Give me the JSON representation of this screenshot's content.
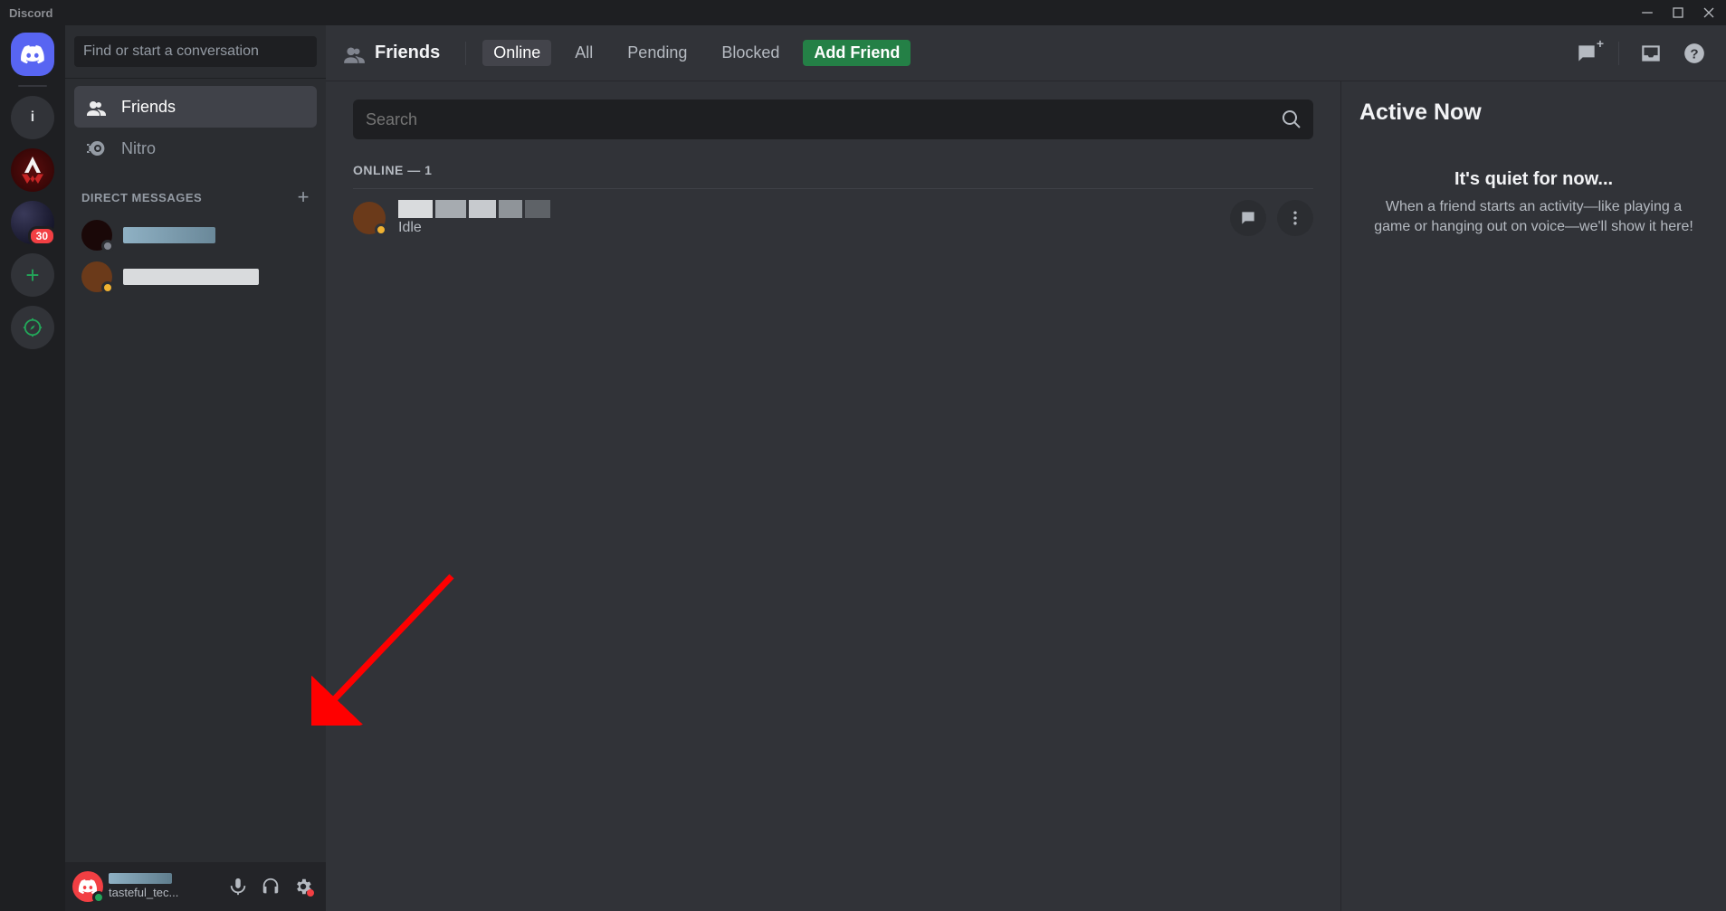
{
  "titlebar": {
    "app_name": "Discord"
  },
  "guilds": {
    "info_label": "i",
    "galaxy_badge": "30"
  },
  "dm": {
    "search_placeholder": "Find or start a conversation",
    "nav": {
      "friends": "Friends",
      "nitro": "Nitro"
    },
    "dm_header": "DIRECT MESSAGES"
  },
  "user": {
    "tag": "tasteful_tec..."
  },
  "header": {
    "title": "Friends",
    "tabs": {
      "online": "Online",
      "all": "All",
      "pending": "Pending",
      "blocked": "Blocked",
      "add_friend": "Add Friend"
    }
  },
  "friends": {
    "search_placeholder": "Search",
    "list_heading": "ONLINE — 1",
    "rows": [
      {
        "status": "Idle"
      }
    ]
  },
  "now": {
    "title": "Active Now",
    "empty_title": "It's quiet for now...",
    "empty_body": "When a friend starts an activity—like playing a game or hanging out on voice—we'll show it here!"
  }
}
